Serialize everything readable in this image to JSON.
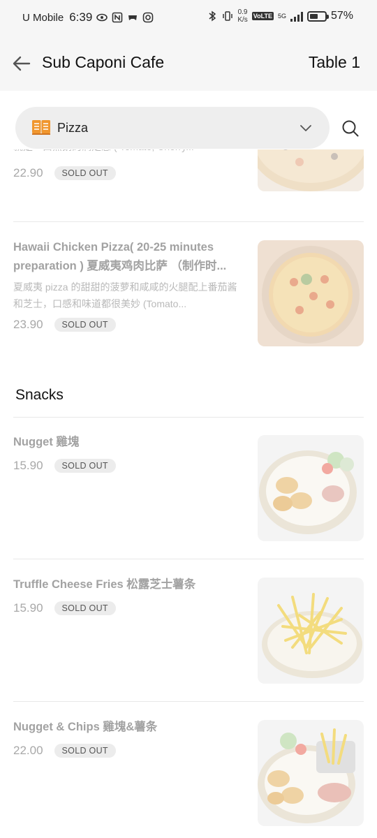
{
  "status": {
    "carrier": "U Mobile",
    "time": "6:39",
    "speed_value": "0.9",
    "speed_unit": "K/s",
    "volte": "VoLTE",
    "network": "5G",
    "battery": "57%",
    "battery_level": 0.57
  },
  "header": {
    "title": "Sub Caponi Cafe",
    "table": "Table 1"
  },
  "category": {
    "selected": "Pizza"
  },
  "menu": {
    "partial_item": {
      "desc": "就是一口熟鹅的满足感 ( Tomato, Cherry...",
      "price": "22.90",
      "status": "SOLD OUT"
    },
    "hawaii": {
      "name": "Hawaii Chicken Pizza( 20-25 minutes preparation ) 夏威夷鸡肉比萨 （制作时...",
      "desc": "夏威夷 pizza 的甜甜的菠萝和咸咸的火腿配上番茄酱和芝士，口感和味道都很美妙 (Tomato...",
      "price": "23.90",
      "status": "SOLD OUT"
    },
    "snacks_title": "Snacks",
    "snacks": [
      {
        "name": "Nugget 雞塊",
        "price": "15.90",
        "status": "SOLD OUT"
      },
      {
        "name": "Truffle Cheese Fries 松露芝士薯条",
        "price": "15.90",
        "status": "SOLD OUT"
      },
      {
        "name": "Nugget & Chips 雞塊&薯条",
        "price": "22.00",
        "status": "SOLD OUT"
      }
    ]
  },
  "colors": {
    "accent_orange": "#f0962e",
    "sold_out_text": "#a2a2a2",
    "badge_bg": "#ececec"
  }
}
